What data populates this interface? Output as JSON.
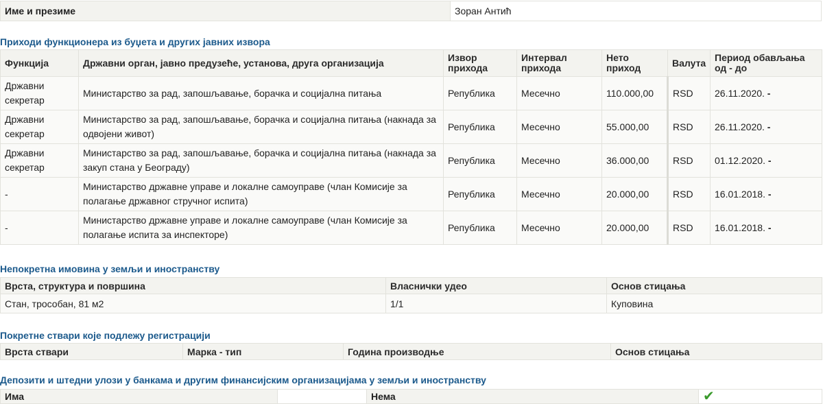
{
  "name_row": {
    "label": "Име и презиме",
    "value": "Зоран Антић"
  },
  "income": {
    "title": "Приходи функционера из буџета и других јавних извора",
    "headers": [
      "Функција",
      "Државни орган, јавно предузеће, установа, друга организација",
      "Извор прихода",
      "Интервал прихода",
      "Нето приход",
      "Валута",
      "Период обављања од - до"
    ],
    "rows": [
      {
        "function": "Државни секретар",
        "organ": "Министарство за рад, запошљавање, борачка и социјална питања",
        "source": "Република",
        "interval": "Месечно",
        "net": "110.000,00",
        "currency": "RSD",
        "period": "26.11.2020."
      },
      {
        "function": "Државни секретар",
        "organ": "Министарство за рад, запошљавање, борачка и социјална питања (накнада за одвојени живот)",
        "source": "Република",
        "interval": "Месечно",
        "net": "55.000,00",
        "currency": "RSD",
        "period": "26.11.2020."
      },
      {
        "function": "Државни секретар",
        "organ": "Министарство за рад, запошљавање, борачка и социјална питања (накнада за закуп стана у Београду)",
        "source": "Република",
        "interval": "Месечно",
        "net": "36.000,00",
        "currency": "RSD",
        "period": "01.12.2020."
      },
      {
        "function": "-",
        "organ": "Министарство државне управе и локалне самоуправе (члан Комисије за полагање државног стручног испита)",
        "source": "Република",
        "interval": "Месечно",
        "net": "20.000,00",
        "currency": "RSD",
        "period": "16.01.2018."
      },
      {
        "function": "-",
        "organ": "Министарство државне управе и локалне самоуправе (члан Комисије за полагање испита за инспекторе)",
        "source": "Република",
        "interval": "Месечно",
        "net": "20.000,00",
        "currency": "RSD",
        "period": "16.01.2018."
      }
    ]
  },
  "property": {
    "title": "Непокретна имовина у земљи и иностранству",
    "headers": [
      "Врста, структура и површина",
      "Власнички удео",
      "Основ стицања"
    ],
    "rows": [
      {
        "type": "Стан, трособан, 81 м2",
        "share": "1/1",
        "basis": "Куповина"
      }
    ]
  },
  "vehicles": {
    "title": "Покретне ствари које подлежу регистрацији",
    "headers": [
      "Врста ствари",
      "Марка - тип",
      "Година производње",
      "Основ стицања"
    ]
  },
  "deposits": {
    "title": "Депозити и штедни улози у банкама и другим финансијским организацијама у земљи и иностранству",
    "has_label": "Има",
    "none_label": "Нема",
    "selected": "Нема",
    "check_icon": "check-icon",
    "check_color": "#3a9a2c"
  }
}
